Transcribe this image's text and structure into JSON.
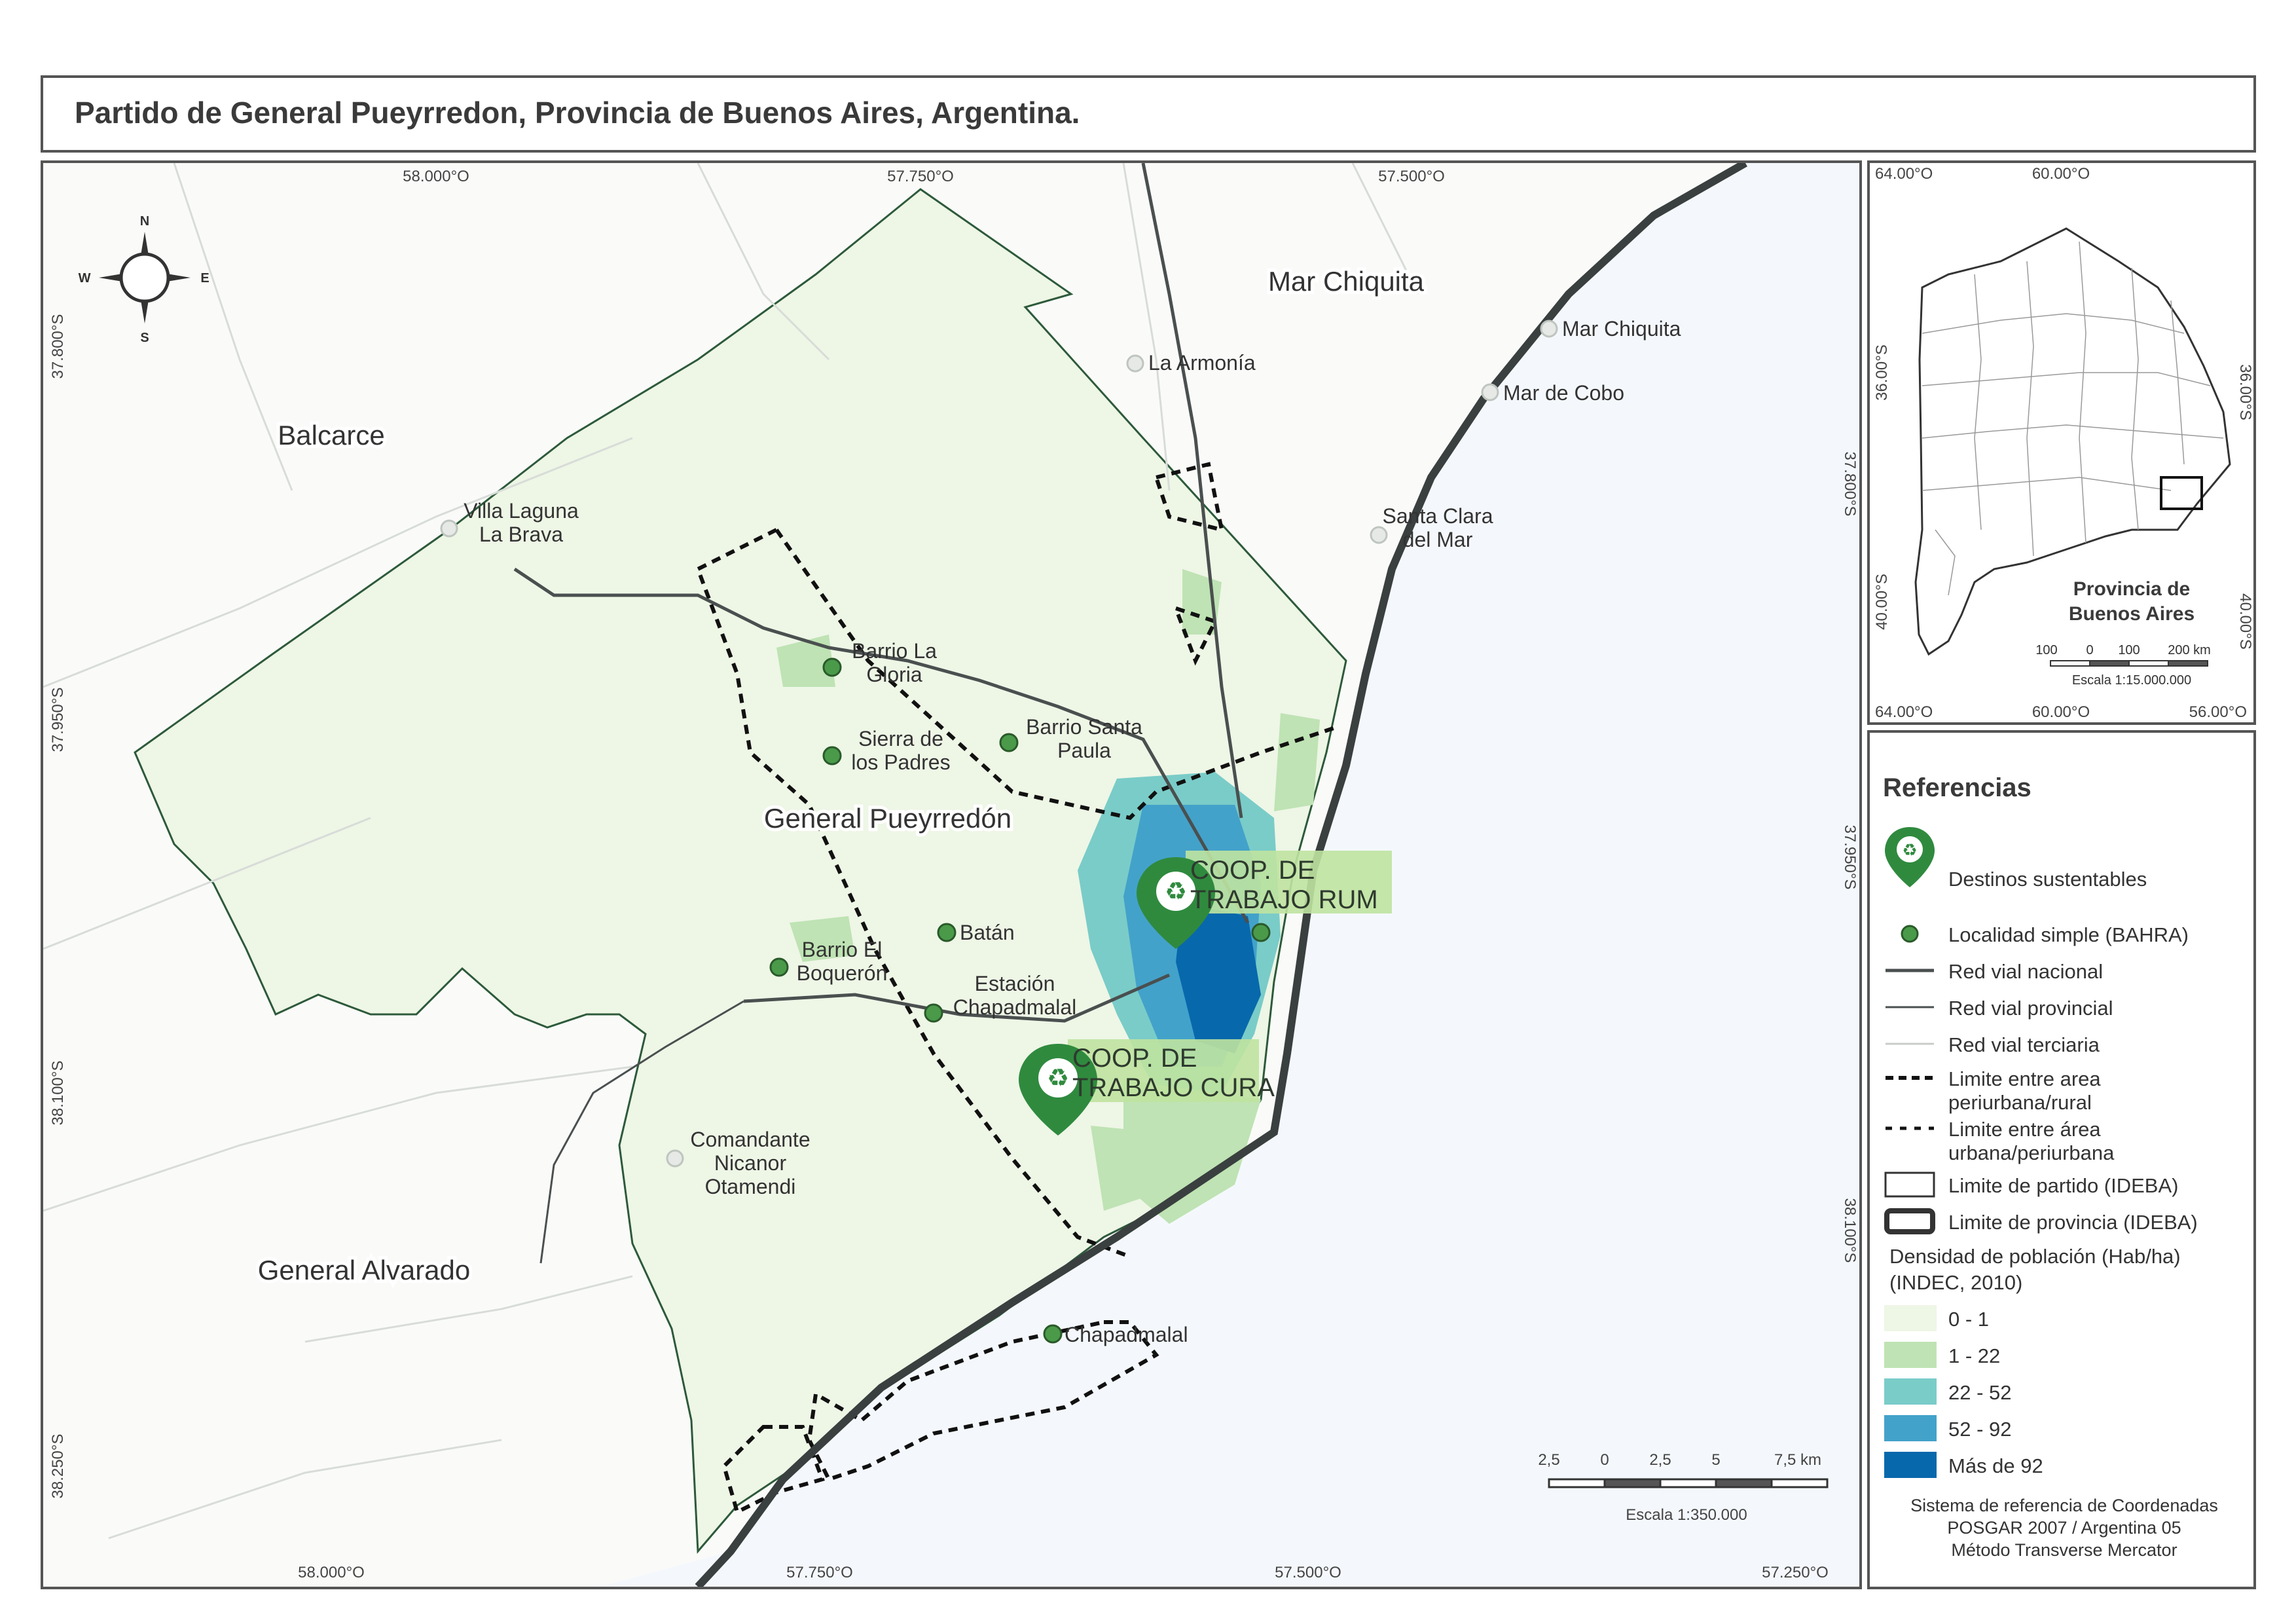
{
  "title": "Partido de General Pueyrredon, Provincia de Buenos Aires, Argentina.",
  "main_map": {
    "top_coords": [
      "58.000°O",
      "57.750°O",
      "57.500°O"
    ],
    "bottom_coords": [
      "58.000°O",
      "57.750°O",
      "57.500°O",
      "57.250°O"
    ],
    "left_coords": [
      "37.800°S",
      "37.950°S",
      "38.100°S",
      "38.250°S"
    ],
    "right_coords": [
      "37.800°S",
      "37.950°S",
      "38.100°S"
    ],
    "compass": {
      "n": "N",
      "s": "S",
      "e": "E",
      "w": "W"
    },
    "regions": {
      "mar_chiquita": "Mar Chiquita",
      "balcarce": "Balcarce",
      "general_pueyrredon": "General Pueyrredón",
      "general_alvarado": "General Alvarado"
    },
    "places": {
      "mar_chiquita": "Mar Chiquita",
      "la_armonia": "La Armonía",
      "mar_de_cobo": "Mar de Cobo",
      "villa_laguna_1": "Villa Laguna",
      "villa_laguna_2": "La Brava",
      "santa_clara_1": "Santa Clara",
      "santa_clara_2": "del Mar",
      "barrio_gloria_1": "Barrio La",
      "barrio_gloria_2": "Gloria",
      "barrio_santa_paula_1": "Barrio Santa",
      "barrio_santa_paula_2": "Paula",
      "sierra_1": "Sierra de",
      "sierra_2": "los Padres",
      "batan": "Batán",
      "boqueron_1": "Barrio El",
      "boqueron_2": "Boquerón",
      "estacion_1": "Estación",
      "estacion_2": "Chapadmalal",
      "otamendi_1": "Comandante",
      "otamendi_2": "Nicanor",
      "otamendi_3": "Otamendi",
      "chapadmalal": "Chapadmalal"
    },
    "coop_rum": [
      "COOP. DE",
      "TRABAJO RUM"
    ],
    "coop_cura": [
      "COOP. DE",
      "TRABAJO CURA"
    ],
    "scale_ticks": [
      "2,5",
      "0",
      "2,5",
      "5",
      "7,5 km"
    ],
    "scale_label": "Escala 1:350.000"
  },
  "inset": {
    "coords_top": [
      "64.00°O",
      "60.00°O"
    ],
    "coords_bottom": [
      "64.00°O",
      "60.00°O",
      "56.00°O"
    ],
    "coords_left": [
      "36.00°S",
      "40.00°S"
    ],
    "coords_right": [
      "36.00°S",
      "40.00°S"
    ],
    "label_1": "Provincia de",
    "label_2": "Buenos Aires",
    "scale_ticks": [
      "100",
      "0",
      "100",
      "200 km"
    ],
    "scale_label": "Escala 1:15.000.000"
  },
  "legend": {
    "title": "Referencias",
    "items": [
      "Destinos sustentables",
      "Localidad simple (BAHRA)",
      "Red vial nacional",
      "Red vial provincial",
      "Red vial terciaria",
      "Limite entre area",
      "periurbana/rural",
      "Limite entre área",
      "urbana/periurbana",
      "Limite de partido (IDEBA)",
      "Limite de provincia (IDEBA)"
    ],
    "density_title_1": "Densidad de población (Hab/ha)",
    "density_title_2": "(INDEC, 2010)",
    "density_classes": [
      {
        "label": "0 - 1",
        "color": "#eef6e6"
      },
      {
        "label": "1 - 22",
        "color": "#bfe3b4"
      },
      {
        "label": "22 - 52",
        "color": "#7accc8"
      },
      {
        "label": "52 - 92",
        "color": "#43a2ca"
      },
      {
        "label": "Más de 92",
        "color": "#0868ac"
      }
    ],
    "crs_1": "Sistema de referencia de Coordenadas",
    "crs_2": "POSGAR 2007 / Argentina 05",
    "crs_3": "Método Transverse Mercator"
  },
  "colors": {
    "partido_fill": "#eef6e6",
    "sea": "#f5f8fc",
    "coast": "#3a3f3f",
    "locality": "#4a9a4a",
    "pin": "#2f8a3e"
  }
}
